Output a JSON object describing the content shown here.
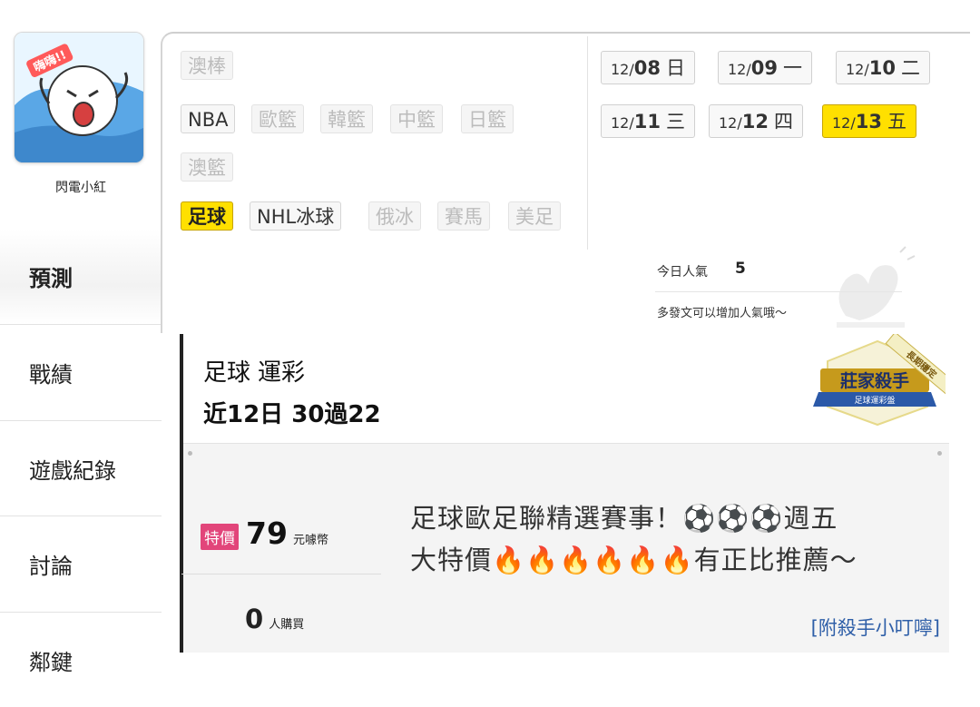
{
  "user": {
    "avatar_text": "嗨嗨!!",
    "name": "閃電小紅"
  },
  "nav": {
    "items": [
      {
        "label": "預測"
      },
      {
        "label": "戰績"
      },
      {
        "label": "遊戲紀錄"
      },
      {
        "label": "討論"
      },
      {
        "label": "鄰鍵"
      }
    ]
  },
  "categories": {
    "row1": [
      "澳棒"
    ],
    "row2": [
      "NBA",
      "歐籃",
      "韓籃",
      "中籃",
      "日籃"
    ],
    "row3": [
      "澳籃"
    ],
    "row4": [
      "足球",
      "NHL冰球",
      "俄冰",
      "賽馬",
      "美足"
    ]
  },
  "dates": [
    {
      "md": "12/",
      "d": "08",
      "wd": "日"
    },
    {
      "md": "12/",
      "d": "09",
      "wd": "一"
    },
    {
      "md": "12/",
      "d": "10",
      "wd": "二"
    },
    {
      "md": "12/",
      "d": "11",
      "wd": "三"
    },
    {
      "md": "12/",
      "d": "12",
      "wd": "四"
    },
    {
      "md": "12/",
      "d": "13",
      "wd": "五"
    }
  ],
  "popularity": {
    "label": "今日人氣",
    "value": "5",
    "hint": "多發文可以增加人氣哦～"
  },
  "card": {
    "sport": "足球",
    "lottery": "運彩",
    "record": "近12日 30過22",
    "badge_title": "莊家殺手",
    "badge_sub": "足球運彩盤",
    "ribbon": "長期穩定",
    "price_tag": "特價",
    "price": "79",
    "price_unit": "元噱幣",
    "buyers": "0",
    "buyers_unit": "人購買",
    "desc_line1": "足球歐足聯精選賽事！⚽⚽⚽週五",
    "desc_line2": "大特價🔥🔥🔥🔥🔥🔥有正比推薦～",
    "tip_link": "[附殺手小叮嚀]"
  },
  "colors": {
    "accent_yellow": "#ffe000",
    "price_tag_bg": "#e2457a",
    "link_blue": "#2f5fa8"
  }
}
